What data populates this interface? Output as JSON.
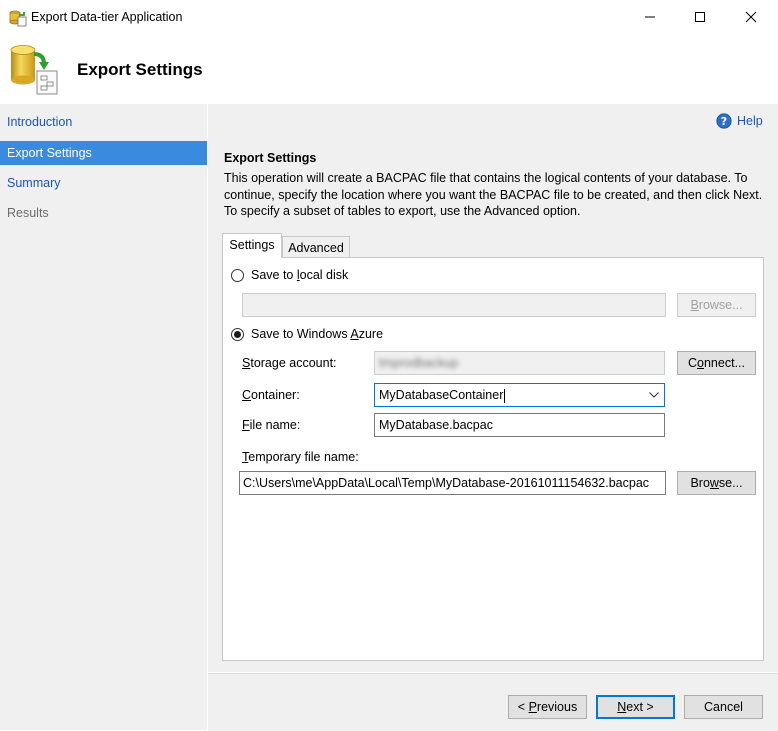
{
  "window": {
    "title": "Export Data-tier Application",
    "icon": "export-app-icon",
    "controls": [
      "minimize-icon",
      "maximize-icon",
      "close-icon"
    ]
  },
  "header": {
    "title": "Export Settings",
    "icon": "database-export-icon"
  },
  "sidebar": {
    "items": [
      {
        "label": "Introduction",
        "state": "link"
      },
      {
        "label": "Export Settings",
        "state": "active"
      },
      {
        "label": "Summary",
        "state": "link"
      },
      {
        "label": "Results",
        "state": "disabled"
      }
    ]
  },
  "help": {
    "label": "Help",
    "icon": "help-icon"
  },
  "section": {
    "title": "Export Settings",
    "description": "This operation will create a BACPAC file that contains the logical contents of your database. To continue, specify the location where you want the BACPAC file to be created, and then click Next. To specify a subset of tables to export, use the Advanced option."
  },
  "tabs": [
    {
      "label": "Settings",
      "selected": true
    },
    {
      "label": "Advanced",
      "selected": false
    }
  ],
  "local_disk": {
    "label_pre": "Save to ",
    "label_key": "l",
    "label_post": "ocal disk",
    "selected": false,
    "path_value": "",
    "browse_label_key": "B",
    "browse_label_post": "rowse..."
  },
  "azure": {
    "label_pre": "Save to Windows ",
    "label_key": "A",
    "label_post": "zure",
    "selected": true,
    "storage_label_key": "S",
    "storage_label_post": "torage account:",
    "storage_value": "tmprodbackup",
    "connect_label_pre": "C",
    "connect_label_key": "o",
    "connect_label_post": "nnect...",
    "container_label_key": "C",
    "container_label_post": "ontainer:",
    "container_value": "MyDatabaseContainer",
    "filename_label_key": "F",
    "filename_label_post": "ile name:",
    "filename_value": "MyDatabase.bacpac",
    "tempfile_label_key": "T",
    "tempfile_label_post": "emporary file name:",
    "tempfile_value": "C:\\Users\\me\\AppData\\Local\\Temp\\MyDatabase-20161011154632.bacpac",
    "browse2_label_key": "w",
    "browse2_label_pre": "Bro",
    "browse2_label_post": "se..."
  },
  "footer": {
    "previous_pre": "< ",
    "previous_key": "P",
    "previous_post": "revious",
    "next_key": "N",
    "next_post": "ext >",
    "cancel_label": "Cancel"
  },
  "colors": {
    "accent": "#0078d7",
    "sidebar_active": "#3a8be0",
    "link": "#1a56b8",
    "panel_bg": "#f0f0f0"
  }
}
